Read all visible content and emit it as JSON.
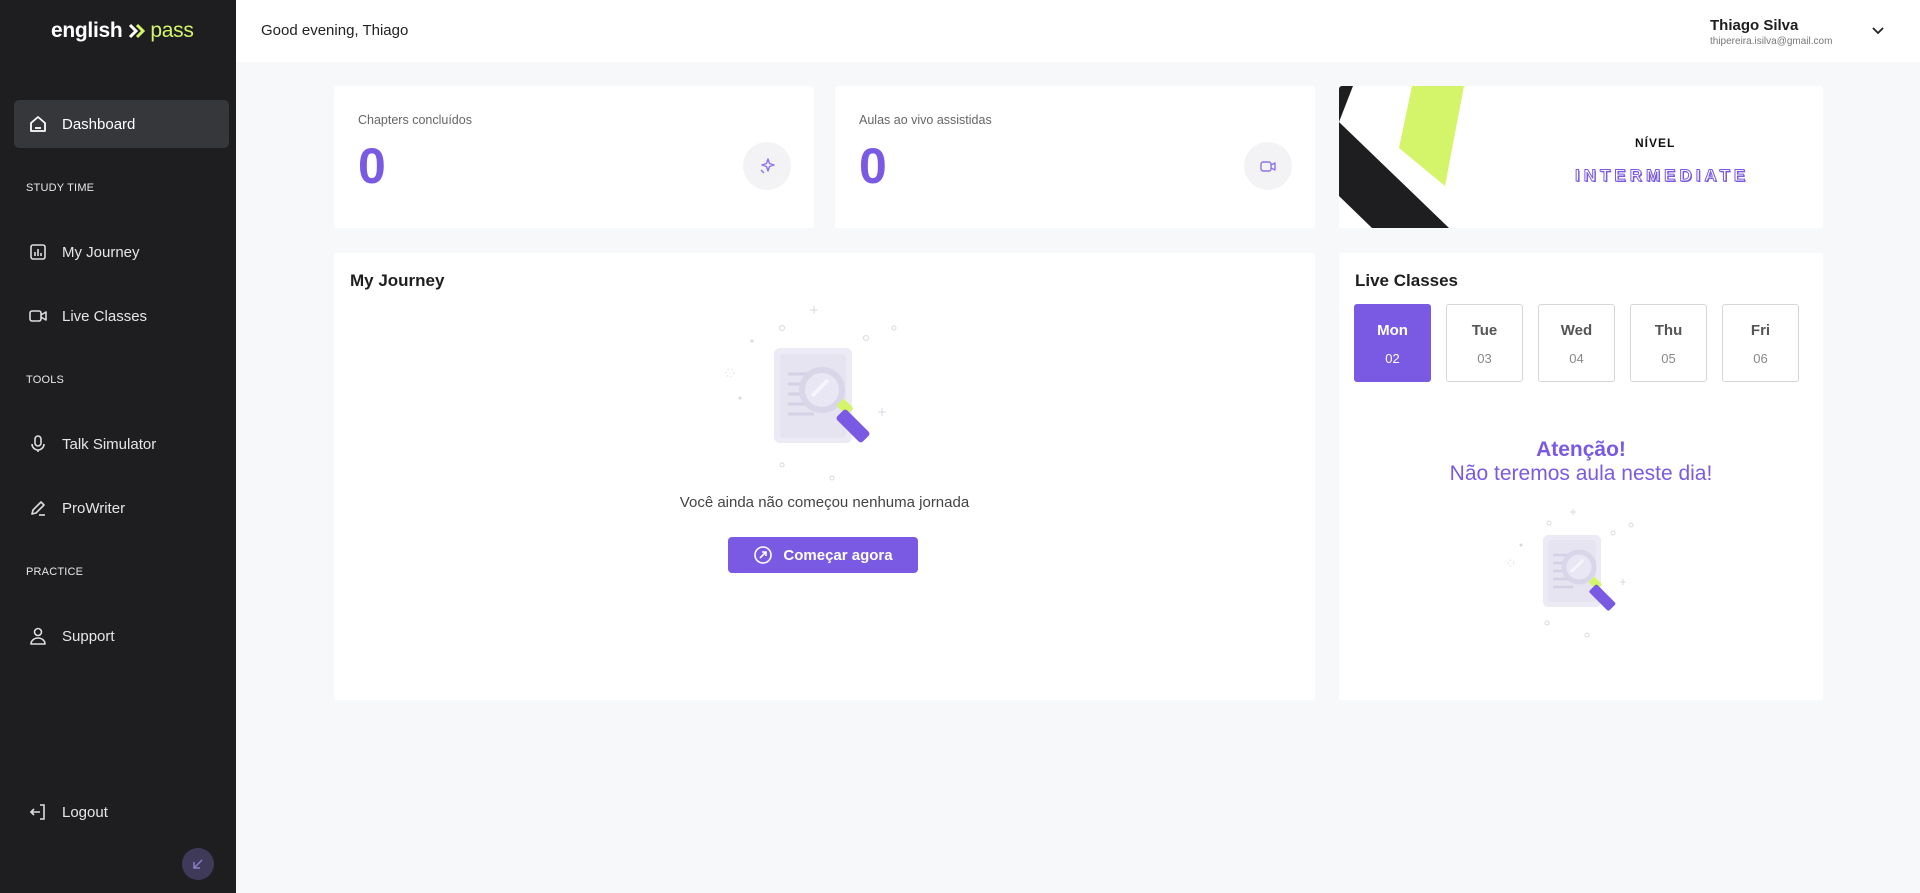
{
  "brand": {
    "word1": "english",
    "word2": "pass"
  },
  "sidebar": {
    "dashboard": "Dashboard",
    "section_study": "STUDY TIME",
    "my_journey": "My Journey",
    "live_classes": "Live Classes",
    "section_tools": "TOOLS",
    "talk_simulator": "Talk Simulator",
    "prowriter": "ProWriter",
    "section_practice": "PRACTICE",
    "support": "Support",
    "logout": "Logout"
  },
  "header": {
    "greeting": "Good evening, Thiago",
    "user_name": "Thiago Silva",
    "user_email": "thipereira.isilva@gmail.com"
  },
  "stats": {
    "chapters_label": "Chapters concluídos",
    "chapters_value": "0",
    "classes_label": "Aulas ao vivo assistidas",
    "classes_value": "0"
  },
  "level": {
    "label": "NÍVEL",
    "value": "INTERMEDIATE"
  },
  "journey": {
    "title": "My Journey",
    "empty_text": "Você ainda não começou nenhuma jornada",
    "start_button": "Começar agora"
  },
  "live_classes": {
    "title": "Live Classes",
    "days": [
      {
        "name": "Mon",
        "date": "02"
      },
      {
        "name": "Tue",
        "date": "03"
      },
      {
        "name": "Wed",
        "date": "04"
      },
      {
        "name": "Thu",
        "date": "05"
      },
      {
        "name": "Fri",
        "date": "06"
      }
    ],
    "selected_day": "Mon",
    "attention_title": "Atenção!",
    "attention_text": "Não teremos aula neste dia!"
  },
  "colors": {
    "accent": "#7a5ae3",
    "lime": "#d4f56a",
    "sidebar": "#1e1e20"
  },
  "icons": [
    "home-icon",
    "chart-icon",
    "video-icon",
    "mic-icon",
    "pen-icon",
    "user-icon",
    "logout-icon",
    "sparkles-icon",
    "chevron-down-icon",
    "arrow-up-right-circle-icon",
    "collapse-arrow-icon"
  ]
}
